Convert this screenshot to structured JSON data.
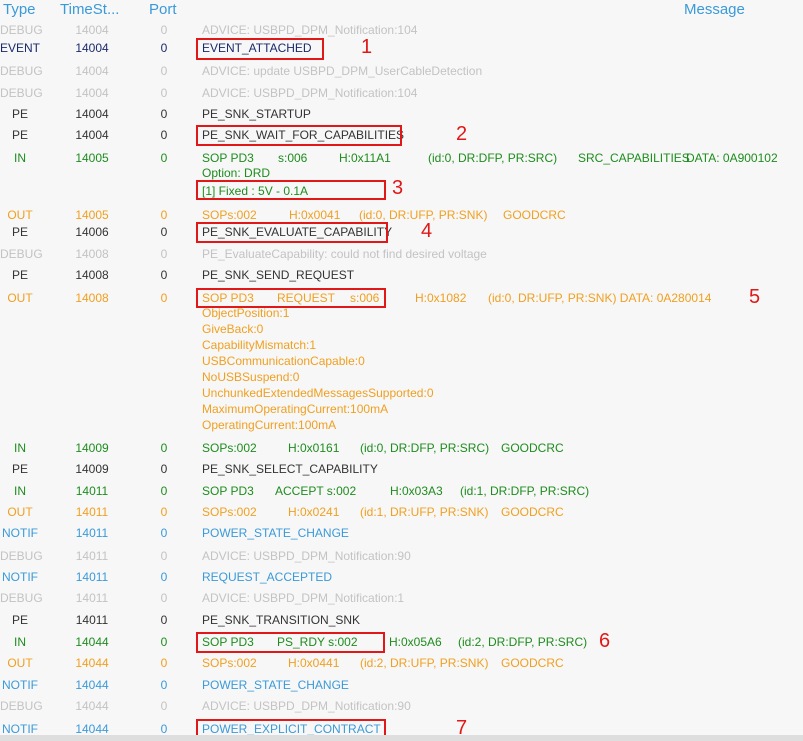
{
  "header": {
    "type": "Type",
    "timestamp": "TimeSt...",
    "port": "Port",
    "message": "Message"
  },
  "rows": [
    {
      "type": "DEBUG",
      "ts": "14004",
      "port": "0",
      "style": "debug",
      "msg": "ADVICE: USBPD_DPM_Notification:104"
    },
    {
      "type": "EVENT",
      "ts": "14004",
      "port": "0",
      "style": "event",
      "msg": "EVENT_ATTACHED"
    },
    {
      "type": "DEBUG",
      "ts": "14004",
      "port": "0",
      "style": "debug",
      "msg": "ADVICE: update USBPD_DPM_UserCableDetection"
    },
    {
      "type": "DEBUG",
      "ts": "14004",
      "port": "0",
      "style": "debug",
      "msg": "ADVICE: USBPD_DPM_Notification:104"
    },
    {
      "type": "PE",
      "ts": "14004",
      "port": "0",
      "style": "pe",
      "msg": "PE_SNK_STARTUP"
    },
    {
      "type": "PE",
      "ts": "14004",
      "port": "0",
      "style": "pe",
      "msg": "PE_SNK_WAIT_FOR_CAPABILITIES"
    },
    {
      "type": "IN",
      "ts": "14005",
      "port": "0",
      "style": "in",
      "tokens": [
        "SOP PD3",
        "s:006",
        "H:0x11A1",
        "(id:0, DR:DFP, PR:SRC)",
        "SRC_CAPABILITIES",
        "DATA: 0A900102"
      ],
      "extra": [
        "Option:   DRD",
        "[1] Fixed : 5V - 0.1A"
      ]
    },
    {
      "type": "OUT",
      "ts": "14005",
      "port": "0",
      "style": "out",
      "tokens": [
        "SOPs:002",
        "H:0x0041",
        "(id:0, DR:UFP, PR:SNK)",
        "GOODCRC"
      ]
    },
    {
      "type": "PE",
      "ts": "14006",
      "port": "0",
      "style": "pe",
      "msg": "PE_SNK_EVALUATE_CAPABILITY"
    },
    {
      "type": "DEBUG",
      "ts": "14008",
      "port": "0",
      "style": "debug",
      "msg": "PE_EvaluateCapability: could not find desired voltage"
    },
    {
      "type": "PE",
      "ts": "14008",
      "port": "0",
      "style": "pe",
      "msg": "PE_SNK_SEND_REQUEST"
    },
    {
      "type": "OUT",
      "ts": "14008",
      "port": "0",
      "style": "out",
      "tokens": [
        "SOP PD3",
        "REQUEST",
        "s:006",
        "H:0x1082",
        "(id:0, DR:UFP, PR:SNK)  DATA: 0A280014"
      ],
      "extra": [
        "ObjectPosition:1",
        "GiveBack:0",
        "CapabilityMismatch:1",
        "USBCommunicationCapable:0",
        "NoUSBSuspend:0",
        "UnchunkedExtendedMessagesSupported:0",
        "MaximumOperatingCurrent:100mA",
        "OperatingCurrent:100mA"
      ]
    },
    {
      "type": "IN",
      "ts": "14009",
      "port": "0",
      "style": "in",
      "tokens": [
        "SOPs:002",
        "H:0x0161",
        "(id:0, DR:DFP, PR:SRC)",
        "GOODCRC"
      ]
    },
    {
      "type": "PE",
      "ts": "14009",
      "port": "0",
      "style": "pe",
      "msg": "PE_SNK_SELECT_CAPABILITY"
    },
    {
      "type": "IN",
      "ts": "14011",
      "port": "0",
      "style": "in",
      "tokens": [
        "SOP PD3",
        "ACCEPT s:002",
        "H:0x03A3",
        "(id:1, DR:DFP, PR:SRC)"
      ]
    },
    {
      "type": "OUT",
      "ts": "14011",
      "port": "0",
      "style": "out",
      "tokens": [
        "SOPs:002",
        "H:0x0241",
        "(id:1, DR:UFP, PR:SNK)",
        "GOODCRC"
      ]
    },
    {
      "type": "NOTIF",
      "ts": "14011",
      "port": "0",
      "style": "notif",
      "msg": "POWER_STATE_CHANGE"
    },
    {
      "type": "DEBUG",
      "ts": "14011",
      "port": "0",
      "style": "debug",
      "msg": "ADVICE: USBPD_DPM_Notification:90"
    },
    {
      "type": "NOTIF",
      "ts": "14011",
      "port": "0",
      "style": "notif",
      "msg": "REQUEST_ACCEPTED"
    },
    {
      "type": "DEBUG",
      "ts": "14011",
      "port": "0",
      "style": "debug",
      "msg": "ADVICE: USBPD_DPM_Notification:1"
    },
    {
      "type": "PE",
      "ts": "14011",
      "port": "0",
      "style": "pe",
      "msg": "PE_SNK_TRANSITION_SNK"
    },
    {
      "type": "IN",
      "ts": "14044",
      "port": "0",
      "style": "in",
      "tokens": [
        "SOP PD3",
        "PS_RDY s:002",
        "H:0x05A6",
        "(id:2, DR:DFP, PR:SRC)"
      ]
    },
    {
      "type": "OUT",
      "ts": "14044",
      "port": "0",
      "style": "out",
      "tokens": [
        "SOPs:002",
        "H:0x0441",
        "(id:2, DR:UFP, PR:SNK)",
        "GOODCRC"
      ]
    },
    {
      "type": "NOTIF",
      "ts": "14044",
      "port": "0",
      "style": "notif",
      "msg": "POWER_STATE_CHANGE"
    },
    {
      "type": "DEBUG",
      "ts": "14044",
      "port": "0",
      "style": "debug",
      "msg": "ADVICE: USBPD_DPM_Notification:90"
    },
    {
      "type": "NOTIF",
      "ts": "14044",
      "port": "0",
      "style": "notif",
      "msg": "POWER_EXPLICIT_CONTRACT"
    }
  ],
  "callouts": [
    "1",
    "2",
    "3",
    "4",
    "5",
    "6",
    "7"
  ],
  "colors": {
    "annotation": "#e01818",
    "header": "#3a9ad9",
    "in": "#1e8c1e",
    "out": "#f0a020",
    "notif": "#3a9ad9",
    "debug": "#c3c3c3",
    "pe": "#333333",
    "event": "#1a2a6c"
  }
}
